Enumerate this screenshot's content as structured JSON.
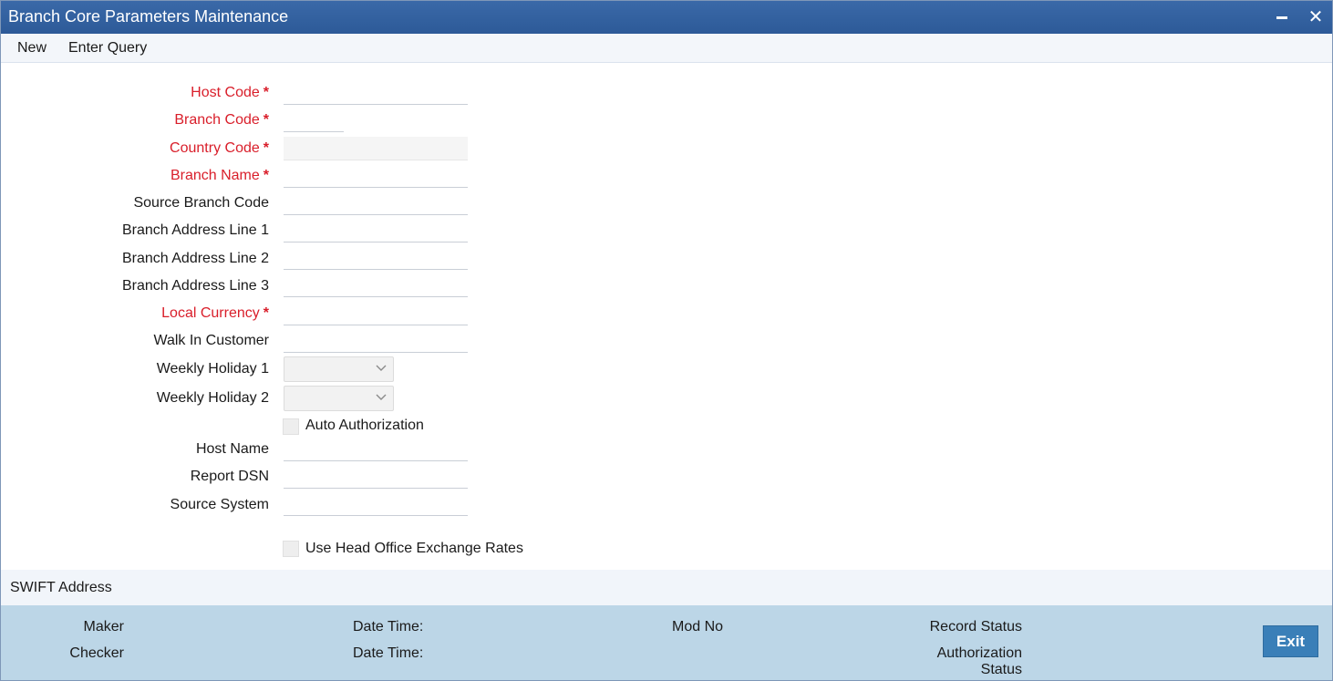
{
  "window": {
    "title": "Branch Core Parameters Maintenance",
    "close_glyph": "✕"
  },
  "menu": {
    "new": "New",
    "enter_query": "Enter Query"
  },
  "form": {
    "host_code": {
      "label": "Host Code",
      "value": ""
    },
    "branch_code": {
      "label": "Branch Code",
      "value": ""
    },
    "country_code": {
      "label": "Country Code",
      "value": ""
    },
    "branch_name": {
      "label": "Branch Name",
      "value": ""
    },
    "source_branch_code": {
      "label": "Source Branch Code",
      "value": ""
    },
    "branch_address_1": {
      "label": "Branch Address Line 1",
      "value": ""
    },
    "branch_address_2": {
      "label": "Branch Address Line 2",
      "value": ""
    },
    "branch_address_3": {
      "label": "Branch Address Line 3",
      "value": ""
    },
    "local_currency": {
      "label": "Local Currency",
      "value": ""
    },
    "walk_in_customer": {
      "label": "Walk In Customer",
      "value": ""
    },
    "weekly_holiday_1": {
      "label": "Weekly Holiday 1",
      "value": ""
    },
    "weekly_holiday_2": {
      "label": "Weekly Holiday 2",
      "value": ""
    },
    "auto_authorization": {
      "label": "Auto Authorization",
      "checked": false
    },
    "host_name": {
      "label": "Host Name",
      "value": ""
    },
    "report_dsn": {
      "label": "Report DSN",
      "value": ""
    },
    "source_system": {
      "label": "Source System",
      "value": ""
    },
    "use_head_office_rates": {
      "label": "Use Head Office Exchange Rates",
      "checked": false
    },
    "required_marker": "*"
  },
  "sections": {
    "swift_address": "SWIFT Address"
  },
  "footer": {
    "maker": "Maker",
    "checker": "Checker",
    "maker_date_time": "Date Time:",
    "checker_date_time": "Date Time:",
    "mod_no": "Mod No",
    "record_status": "Record Status",
    "authorization_status_1": "Authorization",
    "authorization_status_2": "Status",
    "exit": "Exit"
  },
  "colors": {
    "title_bar": "#2d5a98",
    "required_label": "#d91e2a",
    "footer_bg": "#bcd6e7",
    "exit_button": "#3a7fb8"
  }
}
